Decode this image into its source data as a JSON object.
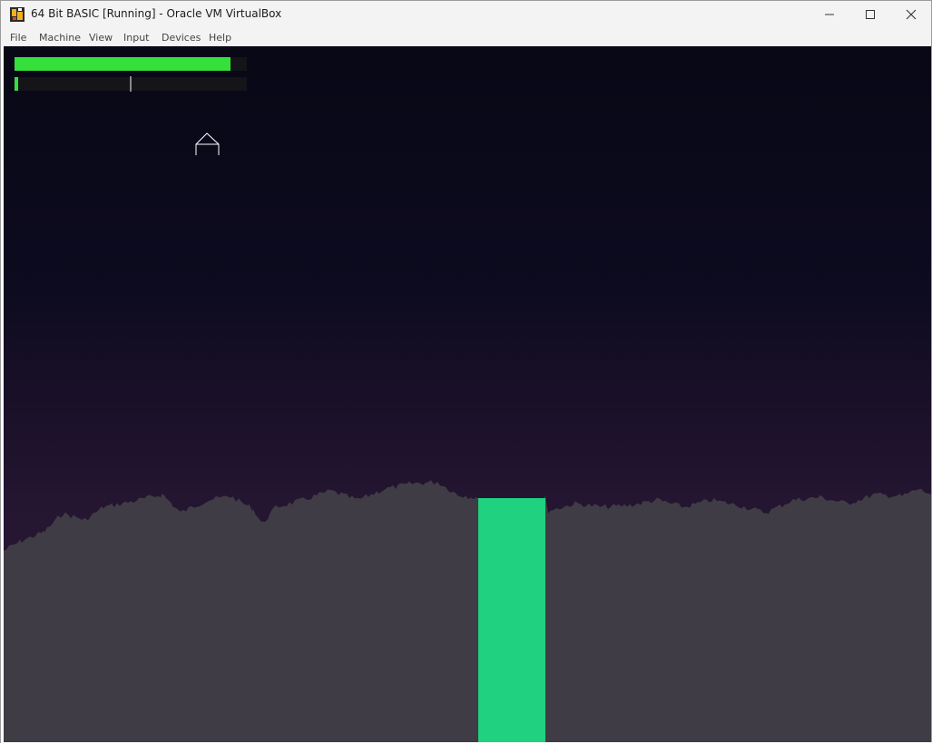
{
  "window": {
    "title": "64 Bit BASIC [Running] - Oracle VM VirtualBox",
    "controls": {
      "minimize_icon": "minimize-icon",
      "maximize_icon": "maximize-icon",
      "close_icon": "close-icon"
    }
  },
  "menu": {
    "file": "File",
    "machine": "Machine",
    "view": "View",
    "input": "Input",
    "devices": "Devices",
    "help": "Help"
  },
  "game": {
    "colors": {
      "sky_top": "#080816",
      "sky_bottom": "#2f1b3b",
      "terrain": "#403c45",
      "landing_pad": "#20d27f",
      "fuel_bar": "#35e03a",
      "gauge_bg": "#141419",
      "ship": "#ffffff"
    },
    "fuel_level": 0.93,
    "thrust_level": 0.015,
    "ship_icon": "lander-ship-icon"
  }
}
